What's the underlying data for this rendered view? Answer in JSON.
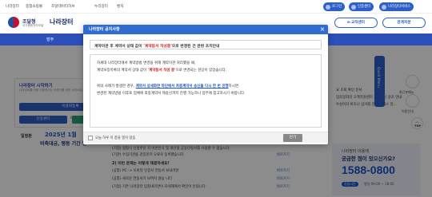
{
  "utility": {
    "links": [
      "나라장터",
      "종합쇼핑몰",
      "조달데이터허브",
      "누리장터",
      "벤처"
    ],
    "login": "로그인",
    "cert": "인증센터",
    "services": "나라장터서비스"
  },
  "logo": {
    "title": "조달청",
    "subtitle": "국가종합전자조달",
    "brand": "나라장터"
  },
  "header_right": {
    "e_order": "e-교직센터",
    "hub": "관계처분"
  },
  "nav": {
    "items": [
      "발주",
      "입찰"
    ]
  },
  "background": {
    "start_title": "나라장터 시작하기",
    "start_desc": "나라장터를 처음 이용하시는 이용자를 위한 서비스입니다.",
    "btn_use": "이용자등록",
    "btn_cert": "인증센터",
    "btn_join": "종합쇼핑몰이용",
    "calendar_label": "일정판",
    "banner_line1": "2025년 1월",
    "banner_line2": "비축대금, 평등 기간 연",
    "page_indicator": "6/9",
    "right_list": [
      "요 조회 확인 문서",
      "입조달처리 고객지원센터 운영혁신 강조 안내",
      "투성이자 비즈니 상거래 관련 서비스 알..."
    ]
  },
  "modal": {
    "title": "나라장터 공지사항",
    "headline_prefix": "계약이관 후 계약서 상태 값이 ",
    "headline_emph": "'계약동서 작성중'",
    "headline_suffix": "으로 변경된 건 관련 조치안내",
    "p1_line1": "차세대 나라장터에서 계약방법 변경을 위해 계약이관 처리했을 때,",
    "p1_line2_prefix": "계약보증목록의 계약서 상태 값이 ",
    "p1_line2_emph": "'계약동서 작성 중'",
    "p1_line2_suffix": "으로 변경되는 현상이 있었습니다.",
    "p2_line1_prefix": "위의 사례가 발생한 경우, ",
    "p2_line1_emph": "계약서 상세화면 하단에서 최종계약서 송신을 다시 한 번 진행",
    "p2_line1_suffix": "하시면",
    "p2_line2": "변경된 계약방법 이후로 업체에 최종계약서 제송신까지 진행 가능하니 업무에 참고하시기 바랍니다.",
    "footer_checkbox": "오늘 하루 이 창을 열지 않음",
    "close_btn": "닫기"
  },
  "lower_list": {
    "items": [
      "(기업) 접합식 신청주인 지 이온인식 및 개인정 공동인정서를 사용할 수 없습니다.",
      "(기관) 수입기관을 검증된지 오류로 등록했습니다.",
      "(공통) PC -> 모바일 인증서 연동서 보내려면",
      "(공통) 새로운 연동서기 보여지 않습 니다",
      "(기업) 기존 나라장터 입찰내리면이 자세해에서 확인이 안됩니다"
    ],
    "more_label": "바로가기",
    "section_heading": "2) 이런 문제는 이렇게 해결하세요!"
  },
  "sidebar_right": {
    "quick_menu": "Quick Menu",
    "recent": "최근본메뉴",
    "favorites": "이용안내",
    "top": "TOP"
  },
  "helpdesk": {
    "line1": "나라장터 이용에",
    "line2": "궁금한 점이 있으신가요?",
    "phone": "1588-0800",
    "badge": "상담시간",
    "hours": "평일 09:00 ~ 18:00"
  },
  "colors": {
    "brand_blue": "#2c4fb8",
    "modal_header": "#2f6bd1",
    "emph_red": "#d01d1d",
    "emph_blue": "#1a55c9"
  }
}
